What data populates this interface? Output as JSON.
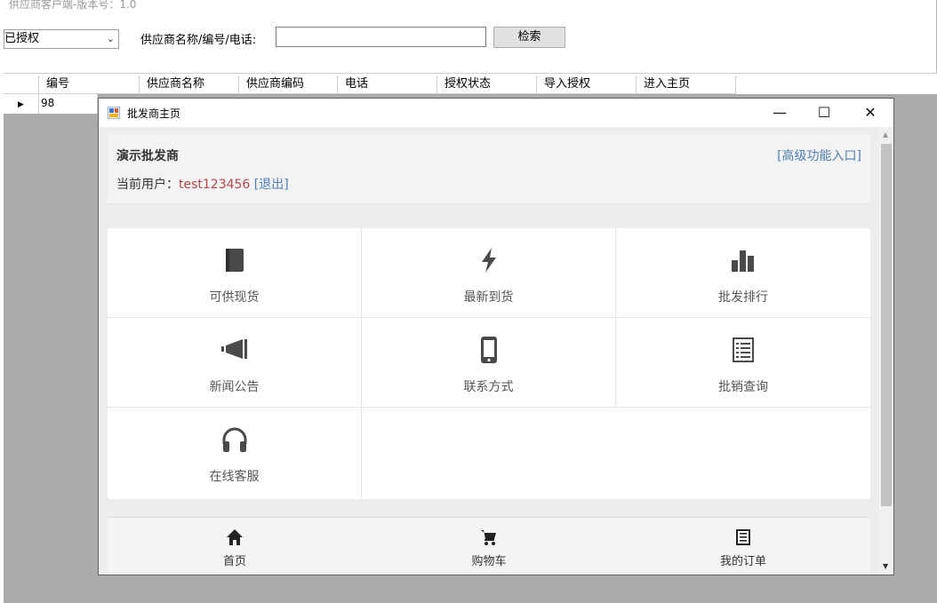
{
  "main_window": {
    "title": "供应商客户端-版本号：1.0",
    "status_filter": "已授权",
    "search_label": "供应商名称/编号/电话:",
    "search_value": "",
    "search_button": "检索",
    "columns": [
      "编号",
      "供应商名称",
      "供应商编码",
      "电话",
      "授权状态",
      "导入授权",
      "进入主页"
    ],
    "rows": [
      {
        "id": "98",
        "name": "",
        "code": "",
        "phone": "",
        "status": "",
        "import": "",
        "home": ""
      }
    ]
  },
  "dialog": {
    "title": "批发商主页",
    "shop_name": "演示批发商",
    "advanced_link": "[高级功能入口]",
    "user_label": "当前用户：",
    "user_name": "test123456",
    "logout_link": "[退出]",
    "tiles": [
      {
        "label": "可供现货",
        "icon": "book-icon"
      },
      {
        "label": "最新到货",
        "icon": "bolt-icon"
      },
      {
        "label": "批发排行",
        "icon": "bar-chart-icon"
      },
      {
        "label": "新闻公告",
        "icon": "bullhorn-icon"
      },
      {
        "label": "联系方式",
        "icon": "mobile-phone-icon"
      },
      {
        "label": "批销查询",
        "icon": "list-icon"
      },
      {
        "label": "在线客服",
        "icon": "headphones-icon"
      }
    ],
    "bottom_nav": [
      {
        "label": "首页",
        "icon": "home-icon"
      },
      {
        "label": "购物车",
        "icon": "cart-icon"
      },
      {
        "label": "我的订单",
        "icon": "order-list-icon"
      }
    ]
  },
  "colors": {
    "accent_link": "#4e7fb5",
    "user_name": "#b5454a",
    "icon": "#4a4a4a",
    "content_bg": "#ecedef",
    "grid_bg": "#ababab"
  }
}
